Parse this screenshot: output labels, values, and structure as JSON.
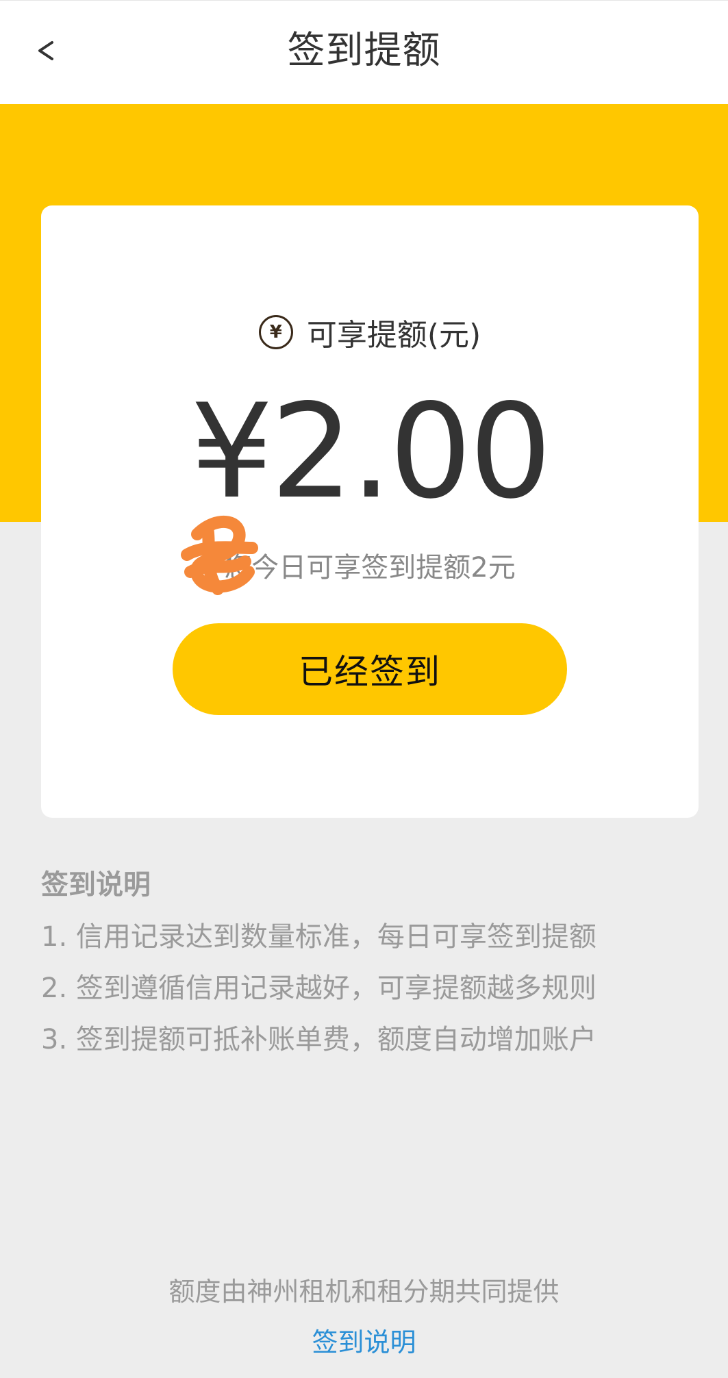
{
  "header": {
    "title": "签到提额",
    "back_icon": "chevron-left-icon"
  },
  "card": {
    "quota_icon": "yen-coin-icon",
    "quota_icon_glyph": "¥",
    "quota_label": "可享提额(元)",
    "amount": "¥2.00",
    "notice": "您今日可享签到提额2元",
    "signed_button_label": "已经签到"
  },
  "rules": {
    "title": "签到说明",
    "items": [
      "1. 信用记录达到数量标准，每日可享签到提额",
      "2. 签到遵循信用记录越好，可享提额越多规则",
      "3. 签到提额可抵补账单费，额度自动增加账户"
    ]
  },
  "footer": {
    "provider_text": "额度由神州租机和租分期共同提供",
    "link_label": "签到说明"
  },
  "colors": {
    "accent_yellow": "#ffc700",
    "background": "#ededed",
    "link_blue": "#2a8fd6",
    "scribble_orange": "#f5883a"
  }
}
